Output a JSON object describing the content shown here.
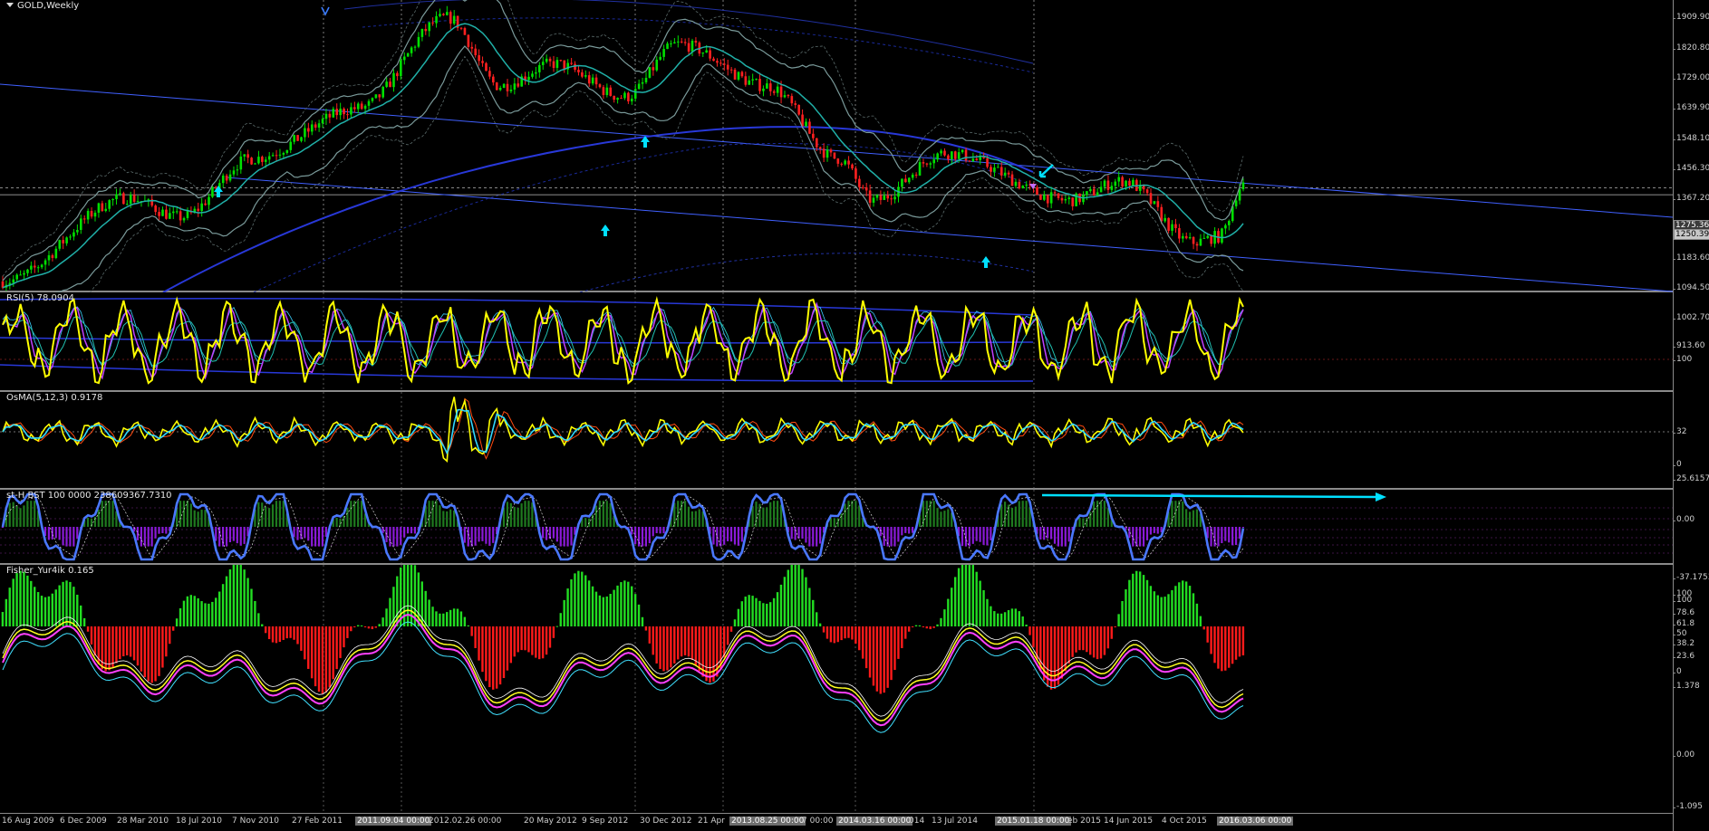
{
  "symbol": "GOLD,Weekly",
  "main": {
    "title": "GOLD,Weekly",
    "price_ticks": [
      "1909.90",
      "1820.80",
      "1729.00",
      "1639.90",
      "1548.10",
      "1456.30",
      "1367.20",
      "1275.36",
      "1250.39",
      "1183.60",
      "1094.50",
      "1002.70",
      "913.60"
    ],
    "current_price": "1250.39",
    "crosshair_price": "1275.36",
    "price_range": [
      913.6,
      1935
    ]
  },
  "rsi": {
    "label": "RSI(5) 78.0904",
    "scale": [
      "100",
      "32",
      "0"
    ]
  },
  "osma": {
    "label": "OsMA(5,12,3) 0.9178",
    "scale": [
      "25.6157",
      "0.00",
      "-37.1753"
    ]
  },
  "stoch": {
    "label": "st-H BST 100 0000 238609367.7310",
    "scale": [
      "100",
      "100",
      "78.6",
      "61.8",
      "50",
      "38.2",
      "23.6",
      "0",
      "100"
    ]
  },
  "fisher": {
    "label": "Fisher_Yur4ik 0.165",
    "scale": [
      "1.378",
      "0.00",
      "-1.095"
    ]
  },
  "time_axis": [
    {
      "label": "16 Aug 2009",
      "highlight": false
    },
    {
      "label": "6 Dec 2009",
      "highlight": false
    },
    {
      "label": "28 Mar 2010",
      "highlight": false
    },
    {
      "label": "18 Jul 2010",
      "highlight": false
    },
    {
      "label": "7 Nov 2010",
      "highlight": false
    },
    {
      "label": "27 Feb 2011",
      "highlight": false
    },
    {
      "label": "2011.09.04 00:00",
      "highlight": true
    },
    {
      "label": "2012.02.26 00:00",
      "highlight": true
    },
    {
      "label": "20 May 2012",
      "highlight": false
    },
    {
      "label": "9 Sep 2012",
      "highlight": false
    },
    {
      "label": "30 Dec 2012",
      "highlight": false
    },
    {
      "label": "21 Apr",
      "highlight": false
    },
    {
      "label": "2013.08.25 00:00",
      "highlight": true
    },
    {
      "label": "7 00:00",
      "highlight": false
    },
    {
      "label": "2014.03.16 00:00",
      "highlight": true
    },
    {
      "label": "014",
      "highlight": false
    },
    {
      "label": "13 Jul 2014",
      "highlight": false
    },
    {
      "label": "2015.01.18 00:00",
      "highlight": true
    },
    {
      "label": "eb 2015",
      "highlight": false
    },
    {
      "label": "14 Jun 2015",
      "highlight": false
    },
    {
      "label": "4 Oct 2015",
      "highlight": false
    },
    {
      "label": "2016.03.06 00:00",
      "highlight": true
    }
  ],
  "colors": {
    "bull_candle": "#00e000",
    "bear_candle": "#ff2020",
    "envelope": "#7a9a9a",
    "ma": "#20b0a8",
    "trendline": "#4060ff",
    "rsi_line": "#ffff00",
    "signal_arrow": "#00e0ff",
    "stoch_line": "#4a78ff",
    "fisher_bull": "#22dd22",
    "fisher_bear": "#ff1a1a"
  }
}
